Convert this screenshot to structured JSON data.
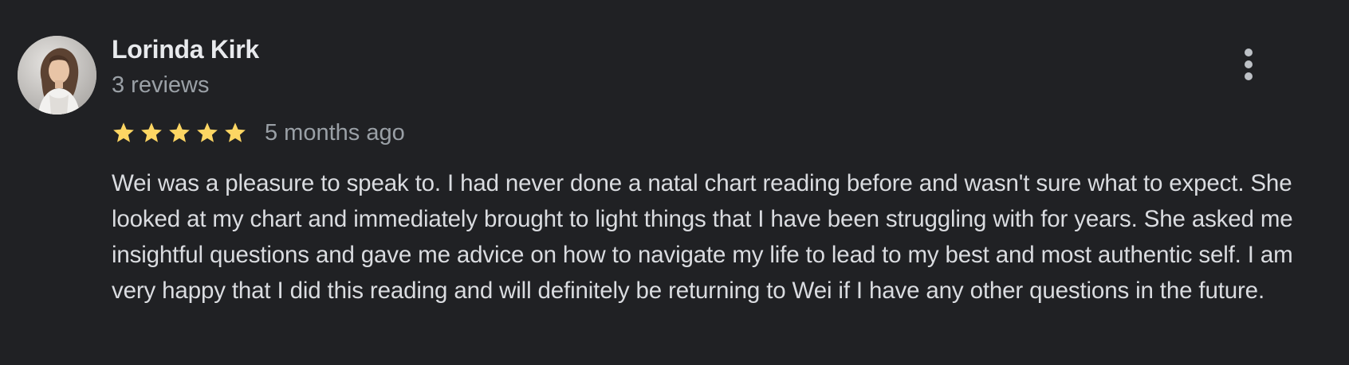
{
  "review": {
    "reviewer_name": "Lorinda Kirk",
    "review_count": "3 reviews",
    "rating": 5,
    "max_rating": 5,
    "date": "5 months ago",
    "text": "Wei was a pleasure to speak to. I had never done a natal chart reading before and wasn't sure what to expect. She looked at my chart and immediately brought to light things that I have been struggling with for years. She asked me insightful questions and gave me advice on how to navigate my life to lead to my best and most authentic self. I am very happy that I did this reading and will definitely be returning to Wei if I have any other questions in the future."
  },
  "icons": {
    "avatar": "avatar-photo",
    "more": "more-vert-icon",
    "star": "star-icon"
  },
  "colors": {
    "background": "#202124",
    "star": "#fdd663",
    "name": "#e8eaed",
    "secondary_text": "#9aa0a6",
    "body_text": "#dadce0",
    "menu_dots": "#bdc1c6"
  }
}
